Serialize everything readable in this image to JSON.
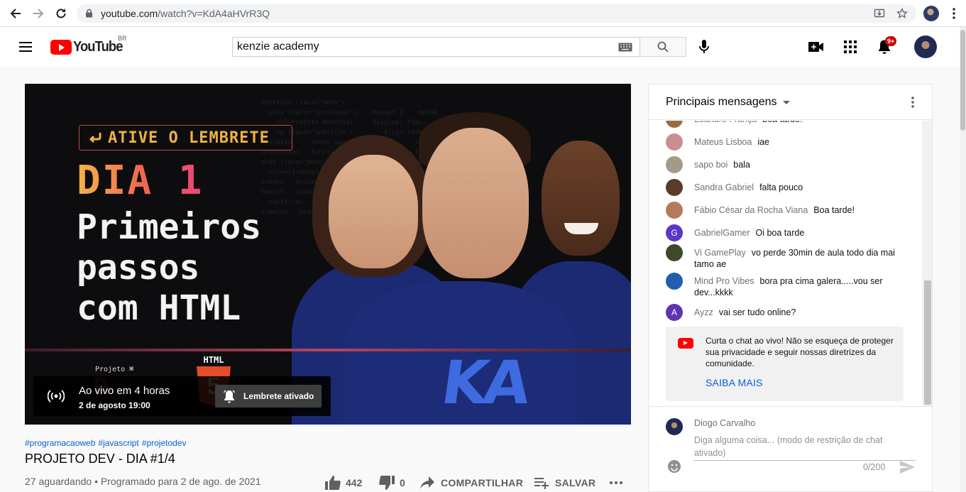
{
  "browser": {
    "url_host": "youtube.com",
    "url_path": "/watch?v=KdA4aHVrR3Q"
  },
  "header": {
    "logo_text": "YouTube",
    "region": "BR",
    "search_value": "kenzie academy",
    "notification_count": "9+"
  },
  "player": {
    "remind_tag": "ATIVE O LEMBRETE",
    "day": "DIA 1",
    "headline": "Primeiros\npassos\ncom HTML",
    "project_label": "Projeto",
    "html_label": "HTML",
    "html_shield_number": "5",
    "shirt_logo": "KA",
    "live_title": "Ao vivo em 4 horas",
    "live_when": "2 de agosto 19:00",
    "reminder_button": "Lembrete ativado"
  },
  "video": {
    "hashtags": [
      "#programacaoweb",
      "#javascript",
      "#projetodev"
    ],
    "title": "PROJETO DEV - DIA #1/4",
    "meta": "27 aguardando • Programado para 2 de ago. de 2021",
    "likes": "442",
    "dislikes": "0",
    "share_label": "COMPARTILHAR",
    "save_label": "SALVAR"
  },
  "chat": {
    "title": "Principais mensagens",
    "messages": [
      {
        "author": "Leandro França",
        "text": "boa tarde!",
        "avatar_color": "#9a6b3c",
        "initial": ""
      },
      {
        "author": "Mateus Lisboa",
        "text": "iae",
        "avatar_color": "#c98f8f",
        "initial": ""
      },
      {
        "author": "sapo boi",
        "text": "bala",
        "avatar_color": "#a59a8a",
        "initial": ""
      },
      {
        "author": "Sandra Gabriel",
        "text": "falta pouco",
        "avatar_color": "#5a3b2a",
        "initial": ""
      },
      {
        "author": "Fábio César da Rocha Viana",
        "text": "Boa tarde!",
        "avatar_color": "#b57a5c",
        "initial": ""
      },
      {
        "author": "GabrielGamer",
        "text": "Oi boa tarde",
        "avatar_color": "#5c35cc",
        "initial": "G"
      },
      {
        "author": "Vi GamePlay",
        "text": "vo perde 30min de aula todo dia mai tamo ae",
        "avatar_color": "#3d4a2a",
        "initial": ""
      },
      {
        "author": "Mind Pro Vibes",
        "text": "bora pra cima galera.....vou ser dev...kkkk",
        "avatar_color": "#1f5fae",
        "initial": ""
      },
      {
        "author": "Ayzz",
        "text": "vai ser tudo online?",
        "avatar_color": "#5e35b1",
        "initial": "A"
      }
    ],
    "notice_text": "Curta o chat ao vivo! Não se esqueça de proteger sua privacidade e seguir nossas diretrizes da comunidade.",
    "notice_link": "SAIBA MAIS",
    "input_user": "Diogo Carvalho",
    "input_placeholder": "Diga alguma coisa... (modo de restrição de chat ativado)",
    "char_count": "0/200"
  }
}
